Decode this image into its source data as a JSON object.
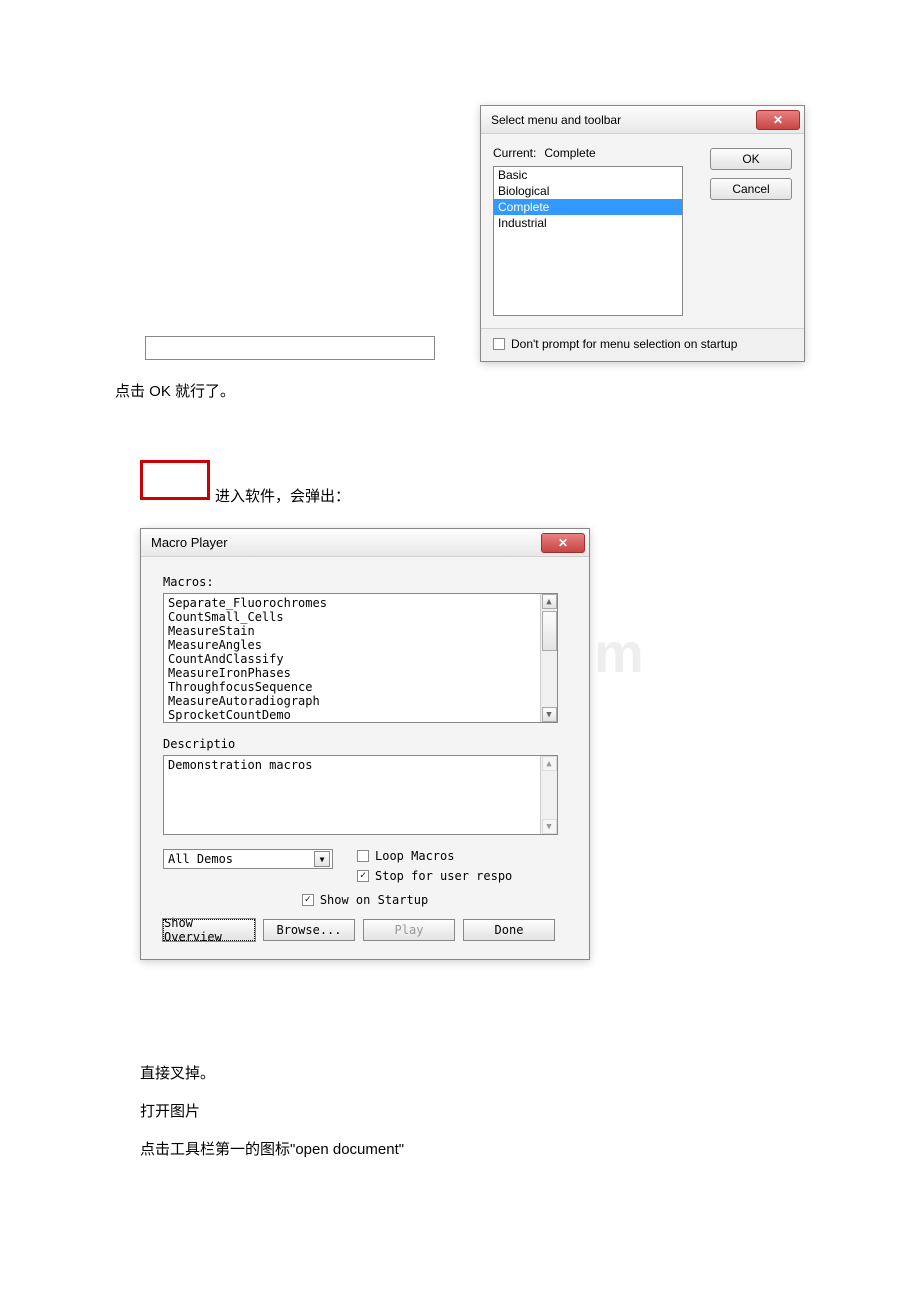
{
  "watermark": "www.bdocx.com",
  "dialog1": {
    "title": "Select menu and toolbar",
    "current_label": "Current:",
    "current_value": "Complete",
    "options": [
      "Basic",
      "Biological",
      "Complete",
      "Industrial"
    ],
    "ok": "OK",
    "cancel": "Cancel",
    "footer_checkbox": "Don't prompt for menu selection on startup"
  },
  "text1": "点击 OK 就行了。",
  "text2": "进入软件，会弹出：",
  "dialog2": {
    "title": "Macro Player",
    "macros_label": "Macros:",
    "macros": [
      "Separate_Fluorochromes",
      "CountSmall_Cells",
      "MeasureStain",
      "MeasureAngles",
      "CountAndClassify",
      "MeasureIronPhases",
      "ThroughfocusSequence",
      "MeasureAutoradiograph",
      "SprocketCountDemo"
    ],
    "desc_label": "Descriptio",
    "desc_text": "Demonstration macros",
    "select_value": "All Demos",
    "loop_macros": "Loop Macros",
    "stop_user": "Stop for user respo",
    "show_startup": "Show on Startup",
    "btn_overview": "Show Overview",
    "btn_browse": "Browse...",
    "btn_play": "Play",
    "btn_done": "Done"
  },
  "text3": "直接叉掉。",
  "text4": "打开图片",
  "text5": "点击工具栏第一的图标\"open document\""
}
